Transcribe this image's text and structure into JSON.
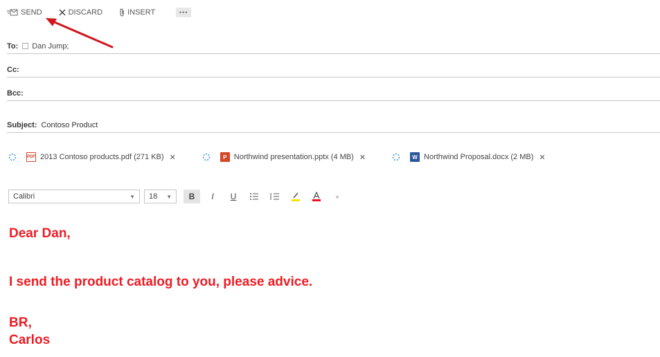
{
  "toolbar": {
    "send_label": "SEND",
    "discard_label": "DISCARD",
    "insert_label": "INSERT",
    "more_label": "•••"
  },
  "fields": {
    "to_label": "To:",
    "to_recipient": "Dan Jump;",
    "cc_label": "Cc:",
    "bcc_label": "Bcc:",
    "subject_label": "Subject:",
    "subject_value": "Contoso Product"
  },
  "attachments": [
    {
      "name": "2013 Contoso products.pdf (271 KB)",
      "icon": "pdf-icon"
    },
    {
      "name": "Northwind presentation.pptx (4 MB)",
      "icon": "pptx-icon"
    },
    {
      "name": "Northwind Proposal.docx (2 MB)",
      "icon": "docx-icon"
    }
  ],
  "format": {
    "font_name": "Calibri",
    "font_size": "18"
  },
  "body": {
    "greeting": "Dear Dan,",
    "line1": "I send the product catalog to you, please advice.",
    "closing": "BR,",
    "signature": "Carlos"
  },
  "colors": {
    "body_text": "#ee1c24",
    "arrow": "#d0161e"
  }
}
